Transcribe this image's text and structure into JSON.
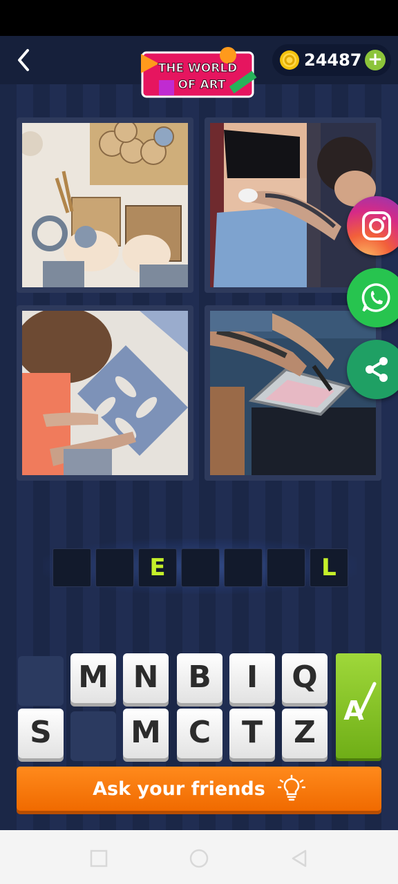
{
  "header": {
    "logo_line1": "THE WORLD",
    "logo_line2": "OF ART",
    "coin_count": "24487",
    "plus_label": "+"
  },
  "photos": [
    {
      "name": "crafting-photo"
    },
    {
      "name": "tattoo-photo"
    },
    {
      "name": "tile-painting-photo"
    },
    {
      "name": "screen-printing-photo"
    }
  ],
  "answer": {
    "slots": [
      "",
      "",
      "E",
      "",
      "",
      "",
      "L"
    ]
  },
  "keyboard": {
    "row1": [
      "",
      "M",
      "N",
      "B",
      "I",
      "Q"
    ],
    "row2": [
      "S",
      "",
      "M",
      "C",
      "T",
      "Z"
    ]
  },
  "hint_button": {
    "letter": "A"
  },
  "ask_button": {
    "label": "Ask your friends"
  },
  "social": [
    "instagram-icon",
    "whatsapp-icon",
    "share-icon"
  ],
  "colors": {
    "accent_green": "#c5f02a",
    "ask_orange": "#f57a0c",
    "hint_green": "#8cc43a"
  }
}
